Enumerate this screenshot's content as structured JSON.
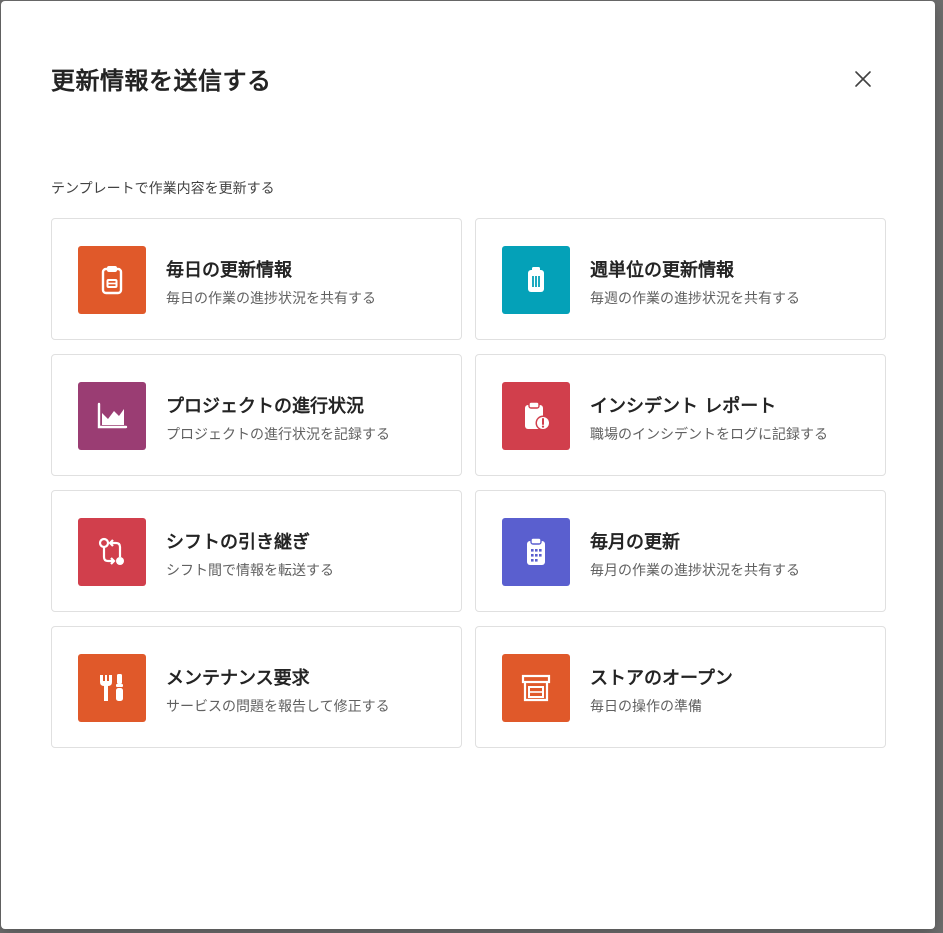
{
  "dialog": {
    "title": "更新情報を送信する",
    "section_label": "テンプレートで作業内容を更新する"
  },
  "templates": [
    {
      "title": "毎日の更新情報",
      "description": "毎日の作業の進捗状況を共有する",
      "icon": "clipboard-icon",
      "color": "#e0592a"
    },
    {
      "title": "週単位の更新情報",
      "description": "毎週の作業の進捗状況を共有する",
      "icon": "trash-bin-icon",
      "color": "#04a1b8"
    },
    {
      "title": "プロジェクトの進行状況",
      "description": "プロジェクトの進行状況を記録する",
      "icon": "area-chart-icon",
      "color": "#9a3d73"
    },
    {
      "title": "インシデント レポート",
      "description": "職場のインシデントをログに記録する",
      "icon": "clipboard-alert-icon",
      "color": "#d13f4c"
    },
    {
      "title": "シフトの引き継ぎ",
      "description": "シフト間で情報を転送する",
      "icon": "handoff-arrows-icon",
      "color": "#d13f4c"
    },
    {
      "title": "毎月の更新",
      "description": "毎月の作業の進捗状況を共有する",
      "icon": "calendar-clipboard-icon",
      "color": "#5a5fcf"
    },
    {
      "title": "メンテナンス要求",
      "description": "サービスの問題を報告して修正する",
      "icon": "wrench-screwdriver-icon",
      "color": "#e0592a"
    },
    {
      "title": "ストアのオープン",
      "description": "毎日の操作の準備",
      "icon": "storefront-icon",
      "color": "#e0592a"
    }
  ]
}
